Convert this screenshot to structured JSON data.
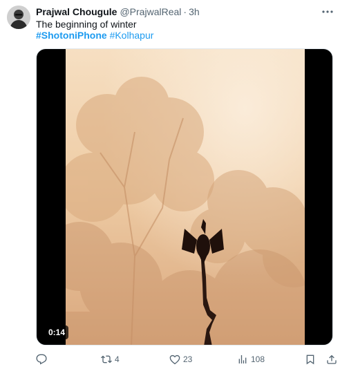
{
  "tweet": {
    "author_name": "Prajwal Chougule",
    "handle": "@PrajwalReal",
    "separator": "·",
    "time": "3h",
    "text": "The beginning of winter",
    "hashtags": [
      "#ShotoniPhone",
      "#Kolhapur"
    ]
  },
  "video": {
    "duration": "0:14"
  },
  "actions": {
    "reply": {
      "icon": "reply-icon",
      "count": ""
    },
    "retweet": {
      "icon": "retweet-icon",
      "count": "4"
    },
    "like": {
      "icon": "heart-icon",
      "count": "23"
    },
    "views": {
      "icon": "views-icon",
      "count": "108"
    },
    "bookmark": {
      "icon": "bookmark-icon"
    },
    "share": {
      "icon": "share-icon"
    }
  },
  "colors": {
    "hashtag": "#1d9bf0",
    "secondary_text": "#536471",
    "primary_text": "#0f1419"
  }
}
